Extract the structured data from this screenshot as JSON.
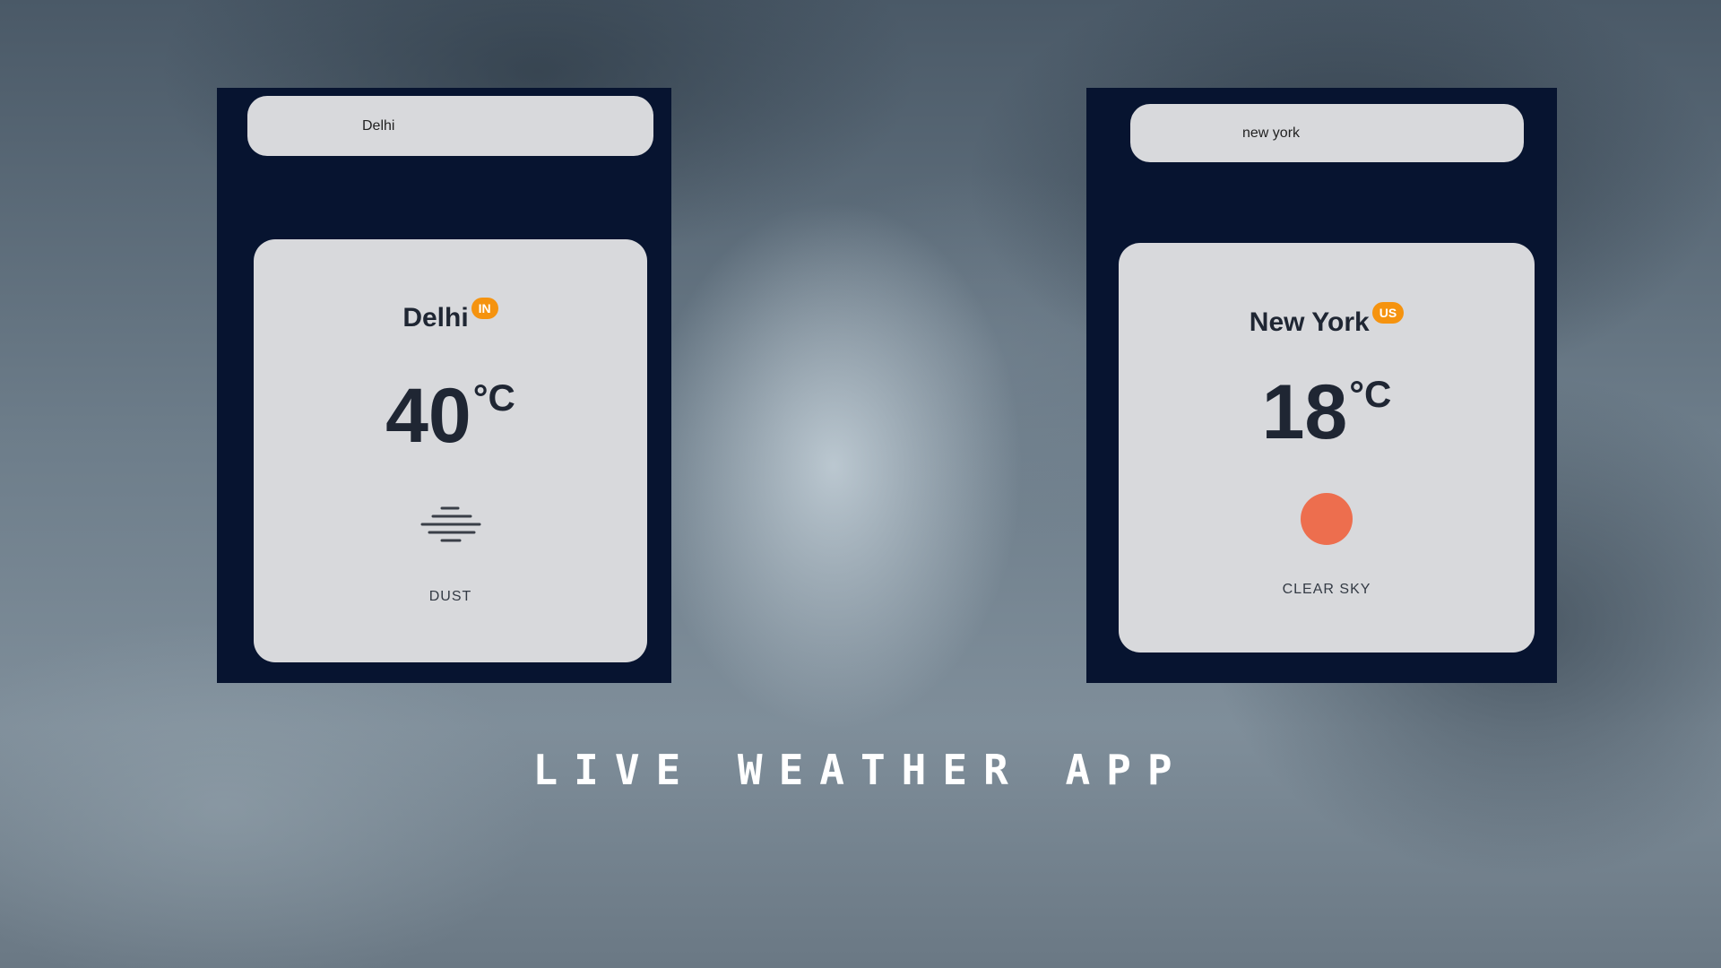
{
  "app": {
    "title": "LIVE WEATHER APP"
  },
  "cards": [
    {
      "search_value": "Delhi",
      "city": "Delhi",
      "country": "IN",
      "temperature": "40",
      "unit": "°C",
      "description": "DUST",
      "icon": "dust-icon"
    },
    {
      "search_value": "new york",
      "city": "New York",
      "country": "US",
      "temperature": "18",
      "unit": "°C",
      "description": "CLEAR SKY",
      "icon": "sun-icon"
    }
  ],
  "colors": {
    "panel": "#071430",
    "card": "#d8d9dc",
    "badge": "#f5930f",
    "sun": "#ed6e4e"
  }
}
